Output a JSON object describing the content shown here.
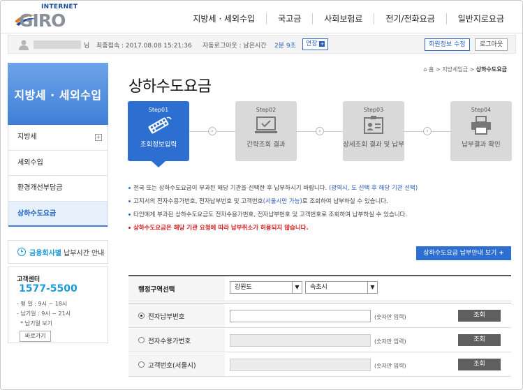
{
  "logo": {
    "top": "INTERNET",
    "main": "GIRO"
  },
  "top_nav": [
    "지방세 · 세외수입",
    "국고금",
    "사회보험료",
    "전기/전화요금",
    "일반지로요금"
  ],
  "user_bar": {
    "suffix": "님",
    "last_login_label": "최종접속 : 2017.08.08 15:21:36",
    "auto_logout_label": "자동로그아웃 : 남은시간",
    "remaining": "2분 9초",
    "extend_label": "연장",
    "edit_profile_label": "회원정보 수정",
    "logout_label": "로그아웃"
  },
  "sidebar": {
    "title": "지방세 · 세외수입",
    "items": [
      {
        "label": "지방세",
        "has_plus": true
      },
      {
        "label": "세외수입"
      },
      {
        "label": "환경개선부담금"
      },
      {
        "label": "상하수도요금",
        "active": true
      }
    ],
    "bank_hours": {
      "highlight": "금융회사별",
      "rest": "납부시간 안내"
    },
    "customer_center": {
      "title": "고객센터",
      "number": "1577-5500",
      "lines": [
        "- 평    일 : 9시 ~ 18시",
        "- 납기일 : 9시 ~ 21시",
        "  * 납기일 보기"
      ],
      "button": "바로가기"
    }
  },
  "breadcrumb": {
    "home": "홈",
    "sep1": ">",
    "level1": "지방세입금",
    "sep2": ">",
    "current": "상하수도요금"
  },
  "page_title": "상하수도요금",
  "steps": [
    {
      "label": "Step01",
      "text": "조회정보입력",
      "active": true
    },
    {
      "label": "Step02",
      "text": "간략조회 결과"
    },
    {
      "label": "Step03",
      "text": "상세조회 결과 및 납부"
    },
    {
      "label": "Step04",
      "text": "납부결과 확인"
    }
  ],
  "notes": [
    {
      "text": "전국 또는 상하수도요금이 부과된 해당 기관을 선택한 후 납부하시기 바랍니다. ",
      "blue": "(광역시, 도 선택 후 해당 기관 선택)"
    },
    {
      "text_a": "고지서의 전자수용가번호, 전자납부번호 및 고객번호",
      "blue": "(서울시만 가능)",
      "text_b": "로 조회하여 납부하실 수 있습니다."
    },
    {
      "text": "타인에게 부과된 상하수도요금도 전자수용가번호, 전자납부번호 및 고객번호로 조회하여 납부하실 수 있습니다."
    },
    {
      "text": "상하수도요금은 해당 기관 요청에 따라 납부취소가 허용되지 않습니다.",
      "red": true
    }
  ],
  "guide_button": "상하수도요금 납부안내 보기",
  "form": {
    "region_label": "행정구역선택",
    "region_1": "강원도",
    "region_2": "속초시",
    "hint": "(숫자만 입력)",
    "query_label": "조회",
    "rows": [
      {
        "label": "전자납부번호",
        "selected": true
      },
      {
        "label": "전자수용가번호",
        "selected": false
      },
      {
        "label": "고객번호(서울시)",
        "selected": false
      }
    ]
  },
  "colors": {
    "primary": "#2d6fd1",
    "accent": "#1c9ad6",
    "warning": "#d01f1f"
  }
}
